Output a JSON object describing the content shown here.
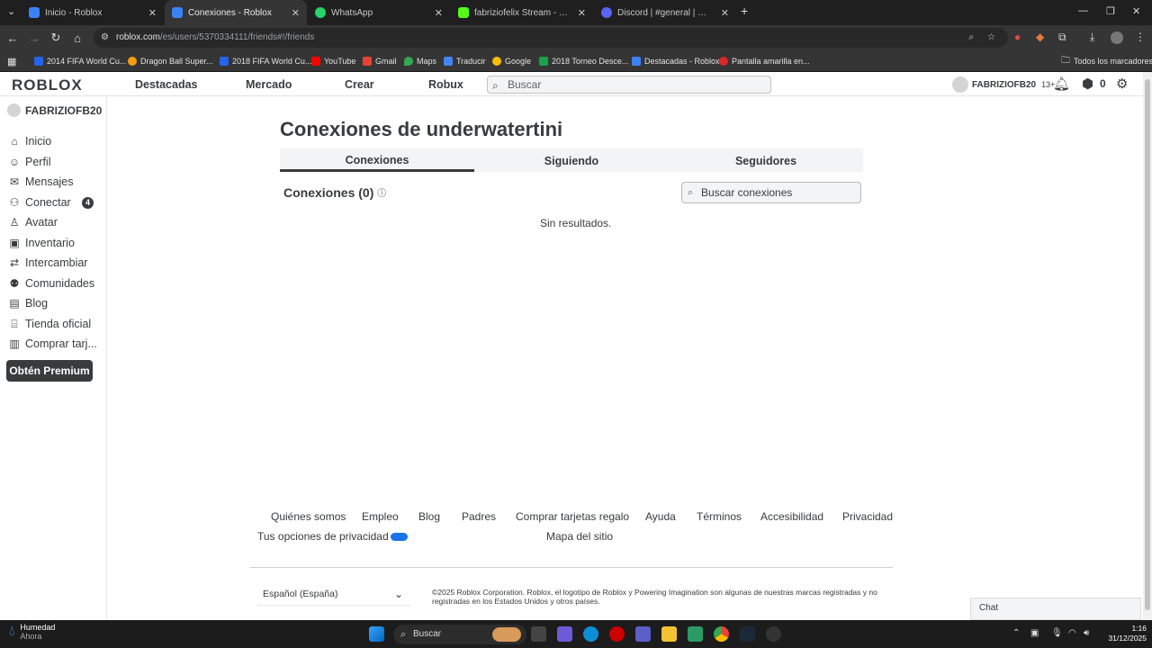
{
  "browser": {
    "tabs": [
      {
        "label": "Inicio - Roblox",
        "color": "#3b82f6"
      },
      {
        "label": "Conexiones - Roblox",
        "color": "#3b82f6"
      },
      {
        "label": "WhatsApp",
        "color": "#25d366"
      },
      {
        "label": "fabriziofelix Stream - Watch",
        "color": "#53fc18"
      },
      {
        "label": "Discord | #general | Xddd",
        "color": "#5865f2"
      }
    ],
    "new_tab_label": "+",
    "url_host": "roblox.com",
    "url_path": "/es/users/5370334111/friends#!/friends",
    "bookmarks": [
      {
        "label": "2014 FIFA World Cu...",
        "color": "#2563eb"
      },
      {
        "label": "Dragon Ball Super...",
        "color": "#f59e0b"
      },
      {
        "label": "2018 FIFA World Cu...",
        "color": "#2563eb"
      },
      {
        "label": "YouTube",
        "color": "#ff0000"
      },
      {
        "label": "Gmail",
        "color": "#ea4335"
      },
      {
        "label": "Maps",
        "color": "#34a853"
      },
      {
        "label": "Traducir",
        "color": "#4285f4"
      },
      {
        "label": "Google",
        "color": "#fbbc05"
      },
      {
        "label": "2018 Torneo Desce...",
        "color": "#16a34a"
      },
      {
        "label": "Destacadas - Roblox",
        "color": "#3b82f6"
      },
      {
        "label": "Pantalla amarilla en...",
        "color": "#dc2626"
      }
    ],
    "all_bookmarks": "Todos los marcadores"
  },
  "header": {
    "logo": "ROBLOX",
    "nav": [
      "Destacadas",
      "Mercado",
      "Crear",
      "Robux"
    ],
    "search_placeholder": "Buscar",
    "username": "FABRIZIOFB20",
    "age": "13+",
    "robux": "0"
  },
  "sidebar": {
    "username": "FABRIZIOFB20",
    "items": [
      {
        "label": "Inicio",
        "icon": "home-icon",
        "glyph": "⌂"
      },
      {
        "label": "Perfil",
        "icon": "profile-icon",
        "glyph": "☺"
      },
      {
        "label": "Mensajes",
        "icon": "messages-icon",
        "glyph": "✉"
      },
      {
        "label": "Conectar",
        "icon": "connect-icon",
        "glyph": "⚇",
        "badge": "4"
      },
      {
        "label": "Avatar",
        "icon": "avatar-icon",
        "glyph": "♙"
      },
      {
        "label": "Inventario",
        "icon": "inventory-icon",
        "glyph": "▣"
      },
      {
        "label": "Intercambiar",
        "icon": "trade-icon",
        "glyph": "⇄"
      },
      {
        "label": "Comunidades",
        "icon": "communities-icon",
        "glyph": "⚉"
      },
      {
        "label": "Blog",
        "icon": "blog-icon",
        "glyph": "▤"
      },
      {
        "label": "Tienda oficial",
        "icon": "store-icon",
        "glyph": "⌸"
      },
      {
        "label": "Comprar tarj...",
        "icon": "gift-card-icon",
        "glyph": "▥"
      }
    ],
    "premium_label": "Obtén Premium"
  },
  "main": {
    "title": "Conexiones de underwatertini",
    "tabs": [
      "Conexiones",
      "Siguiendo",
      "Seguidores"
    ],
    "section_title": "Conexiones (0)",
    "search_placeholder": "Buscar conexiones",
    "empty_text": "Sin resultados."
  },
  "footer": {
    "links": [
      "Quiénes somos",
      "Empleo",
      "Blog",
      "Padres",
      "Comprar tarjetas regalo",
      "Ayuda",
      "Términos",
      "Accesibilidad",
      "Privacidad"
    ],
    "privacy_options": "Tus opciones de privacidad",
    "sitemap": "Mapa del sitio",
    "language": "Español (España)",
    "copyright": "©2025 Roblox Corporation. Roblox, el logotipo de Roblox y Powering Imagination son algunas de nuestras marcas registradas y no registradas en los Estados Unidos y otros países."
  },
  "chat": {
    "label": "Chat"
  },
  "taskbar": {
    "weather_title": "Humedad",
    "weather_sub": "Ahora",
    "search_label": "Buscar",
    "time": "1:16",
    "date": "31/12/2025"
  }
}
